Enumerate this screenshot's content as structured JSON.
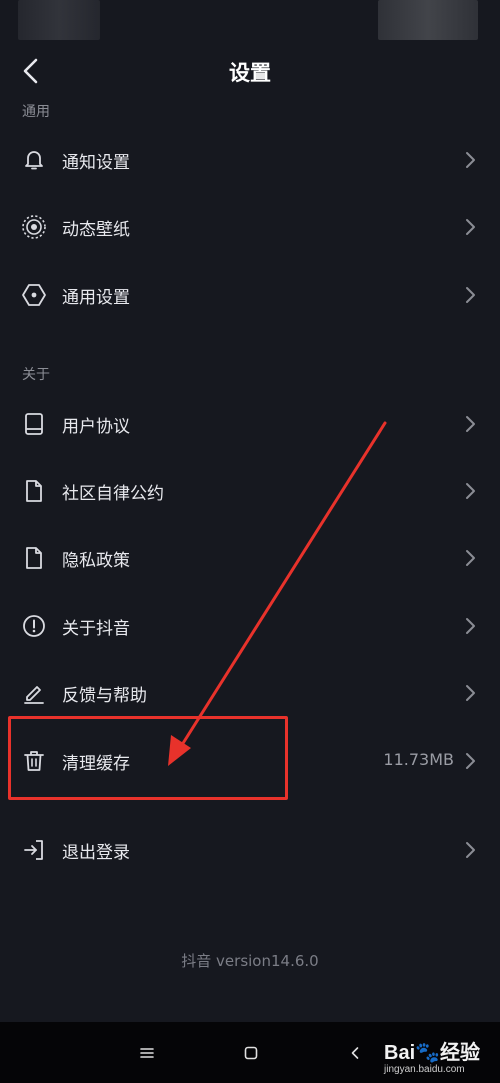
{
  "header": {
    "title": "设置"
  },
  "sections": {
    "general": "通用",
    "about": "关于"
  },
  "items": {
    "notify": {
      "label": "通知设置",
      "icon": "bell-icon"
    },
    "wallpaper": {
      "label": "动态壁纸",
      "icon": "live-wallpaper-icon"
    },
    "general": {
      "label": "通用设置",
      "icon": "hexagon-settings-icon"
    },
    "agreement": {
      "label": "用户协议",
      "icon": "book-icon"
    },
    "community": {
      "label": "社区自律公约",
      "icon": "document-icon"
    },
    "privacy": {
      "label": "隐私政策",
      "icon": "document-icon"
    },
    "about": {
      "label": "关于抖音",
      "icon": "info-circle-icon"
    },
    "feedback": {
      "label": "反馈与帮助",
      "icon": "pencil-icon"
    },
    "cache": {
      "label": "清理缓存",
      "value": "11.73MB",
      "icon": "trash-icon"
    },
    "logout": {
      "label": "退出登录",
      "icon": "logout-icon"
    }
  },
  "footer": {
    "version": "抖音 version14.6.0"
  },
  "watermark": {
    "brand": "Bai🐾经验",
    "url": "jingyan.baidu.com"
  },
  "colors": {
    "background": "#16181f",
    "annotation": "#e8322b",
    "nav_bar": "#050507"
  }
}
